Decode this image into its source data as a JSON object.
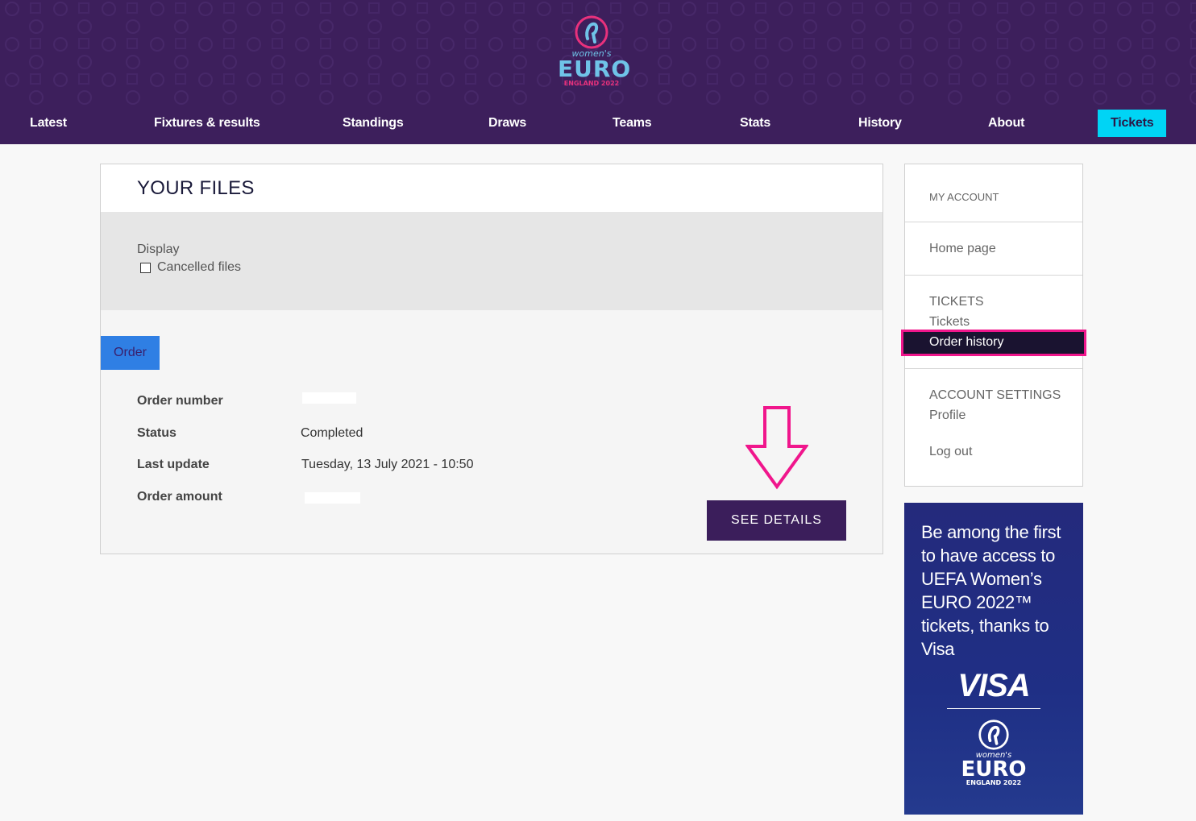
{
  "header": {
    "logo": {
      "wordmark_small": "women's",
      "wordmark": "EURO",
      "subline": "ENGLAND 2022"
    },
    "nav": [
      {
        "label": "Latest"
      },
      {
        "label": "Fixtures & results"
      },
      {
        "label": "Standings"
      },
      {
        "label": "Draws"
      },
      {
        "label": "Teams"
      },
      {
        "label": "Stats"
      },
      {
        "label": "History"
      },
      {
        "label": "About"
      },
      {
        "label": "Tickets",
        "highlight_color": "#00d4f5"
      }
    ]
  },
  "main": {
    "title": "YOUR FILES",
    "filter": {
      "label": "Display",
      "checkbox_label": "Cancelled files",
      "checked": false
    },
    "tab": {
      "label": "Order"
    },
    "order": {
      "rows": [
        {
          "key": "Order number",
          "value": ""
        },
        {
          "key": "Status",
          "value": "Completed"
        },
        {
          "key": "Last update",
          "value": "Tuesday, 13 July 2021 - 10:50"
        },
        {
          "key": "Order amount",
          "value": ""
        }
      ]
    },
    "see_details_label": "SEE DETAILS",
    "annotation_arrow_color": "#f0168c"
  },
  "sidebar": {
    "my_account": "MY ACCOUNT",
    "home_page": "Home page",
    "tickets_heading": "TICKETS",
    "tickets_link": "Tickets",
    "order_history": "Order history",
    "account_settings": "ACCOUNT SETTINGS",
    "profile": "Profile",
    "log_out": "Log out"
  },
  "ad": {
    "text": "Be among the first to have access to UEFA Women’s EURO 2022™ tickets, thanks to Visa",
    "brand": "VISA",
    "logo_small": "women's",
    "logo_word": "EURO",
    "logo_sub": "ENGLAND 2022"
  },
  "colors": {
    "header_bg": "#3d1f5c",
    "button_bg": "#3b1e5b",
    "tab_bg": "#2f7fe4",
    "highlight": "#f0168c"
  }
}
